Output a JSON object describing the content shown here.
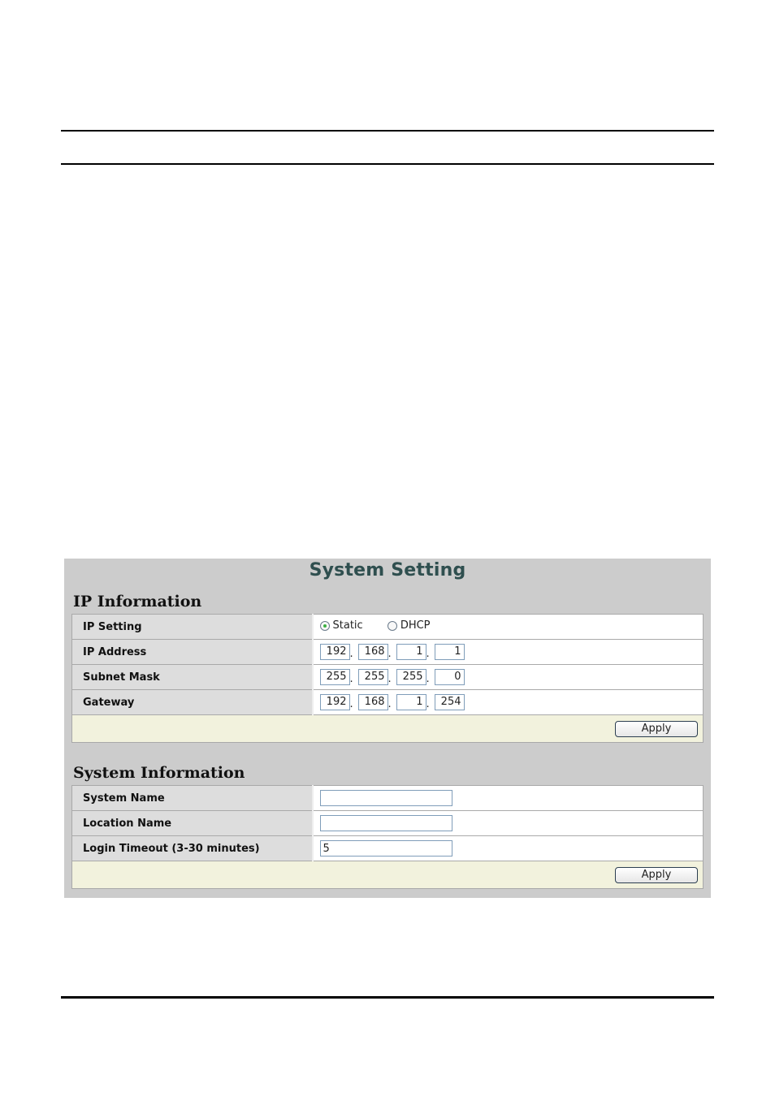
{
  "page": {
    "title": "System Setting"
  },
  "ip_information": {
    "heading": "IP Information",
    "rows": {
      "ip_setting": {
        "label": "IP Setting",
        "options": [
          {
            "label": "Static",
            "selected": true
          },
          {
            "label": "DHCP",
            "selected": false
          }
        ]
      },
      "ip_address": {
        "label": "IP Address",
        "octets": [
          "192",
          "168",
          "1",
          "1"
        ]
      },
      "subnet_mask": {
        "label": "Subnet Mask",
        "octets": [
          "255",
          "255",
          "255",
          "0"
        ]
      },
      "gateway": {
        "label": "Gateway",
        "octets": [
          "192",
          "168",
          "1",
          "254"
        ]
      }
    },
    "apply_label": "Apply"
  },
  "system_information": {
    "heading": "System Information",
    "rows": {
      "system_name": {
        "label": "System Name",
        "value": ""
      },
      "location_name": {
        "label": "Location Name",
        "value": ""
      },
      "login_timeout": {
        "label": "Login Timeout (3-30 minutes)",
        "value": "5"
      }
    },
    "apply_label": "Apply"
  },
  "separator": "."
}
